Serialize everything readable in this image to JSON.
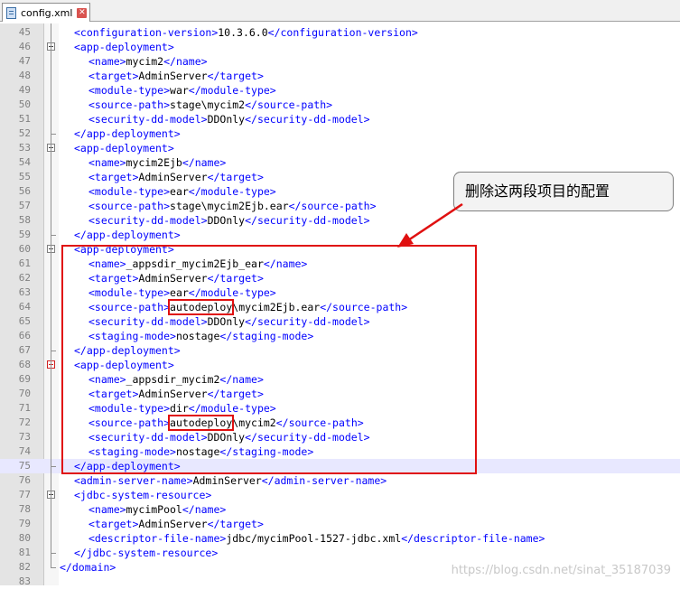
{
  "tab": {
    "label": "config.xml",
    "close": "✕"
  },
  "callout": "删除这两段项目的配置",
  "watermark": "https://blog.csdn.net/sinat_35187039",
  "lines": [
    {
      "n": "45",
      "indent": 1,
      "parts": [
        [
          "t",
          "<configuration-version>"
        ],
        [
          "x",
          "10.3.6.0"
        ],
        [
          "t",
          "</configuration-version>"
        ]
      ]
    },
    {
      "n": "46",
      "indent": 1,
      "fold": "open",
      "parts": [
        [
          "t",
          "<app-deployment>"
        ]
      ]
    },
    {
      "n": "47",
      "indent": 2,
      "parts": [
        [
          "t",
          "<name>"
        ],
        [
          "x",
          "mycim2"
        ],
        [
          "t",
          "</name>"
        ]
      ]
    },
    {
      "n": "48",
      "indent": 2,
      "parts": [
        [
          "t",
          "<target>"
        ],
        [
          "x",
          "AdminServer"
        ],
        [
          "t",
          "</target>"
        ]
      ]
    },
    {
      "n": "49",
      "indent": 2,
      "parts": [
        [
          "t",
          "<module-type>"
        ],
        [
          "x",
          "war"
        ],
        [
          "t",
          "</module-type>"
        ]
      ]
    },
    {
      "n": "50",
      "indent": 2,
      "parts": [
        [
          "t",
          "<source-path>"
        ],
        [
          "x",
          "stage\\mycim2"
        ],
        [
          "t",
          "</source-path>"
        ]
      ]
    },
    {
      "n": "51",
      "indent": 2,
      "parts": [
        [
          "t",
          "<security-dd-model>"
        ],
        [
          "x",
          "DDOnly"
        ],
        [
          "t",
          "</security-dd-model>"
        ]
      ]
    },
    {
      "n": "52",
      "indent": 1,
      "fold": "end",
      "parts": [
        [
          "t",
          "</app-deployment>"
        ]
      ]
    },
    {
      "n": "53",
      "indent": 1,
      "fold": "open",
      "parts": [
        [
          "t",
          "<app-deployment>"
        ]
      ]
    },
    {
      "n": "54",
      "indent": 2,
      "parts": [
        [
          "t",
          "<name>"
        ],
        [
          "x",
          "mycim2Ejb"
        ],
        [
          "t",
          "</name>"
        ]
      ]
    },
    {
      "n": "55",
      "indent": 2,
      "parts": [
        [
          "t",
          "<target>"
        ],
        [
          "x",
          "AdminServer"
        ],
        [
          "t",
          "</target>"
        ]
      ]
    },
    {
      "n": "56",
      "indent": 2,
      "parts": [
        [
          "t",
          "<module-type>"
        ],
        [
          "x",
          "ear"
        ],
        [
          "t",
          "</module-type>"
        ]
      ]
    },
    {
      "n": "57",
      "indent": 2,
      "parts": [
        [
          "t",
          "<source-path>"
        ],
        [
          "x",
          "stage\\mycim2Ejb.ear"
        ],
        [
          "t",
          "</source-path>"
        ]
      ]
    },
    {
      "n": "58",
      "indent": 2,
      "parts": [
        [
          "t",
          "<security-dd-model>"
        ],
        [
          "x",
          "DDOnly"
        ],
        [
          "t",
          "</security-dd-model>"
        ]
      ]
    },
    {
      "n": "59",
      "indent": 1,
      "fold": "end",
      "parts": [
        [
          "t",
          "</app-deployment>"
        ]
      ]
    },
    {
      "n": "60",
      "indent": 1,
      "fold": "open",
      "parts": [
        [
          "t",
          "<app-deployment>"
        ]
      ]
    },
    {
      "n": "61",
      "indent": 2,
      "parts": [
        [
          "t",
          "<name>"
        ],
        [
          "x",
          "_appsdir_mycim2Ejb_ear"
        ],
        [
          "t",
          "</name>"
        ]
      ]
    },
    {
      "n": "62",
      "indent": 2,
      "parts": [
        [
          "t",
          "<target>"
        ],
        [
          "x",
          "AdminServer"
        ],
        [
          "t",
          "</target>"
        ]
      ]
    },
    {
      "n": "63",
      "indent": 2,
      "parts": [
        [
          "t",
          "<module-type>"
        ],
        [
          "x",
          "ear"
        ],
        [
          "t",
          "</module-type>"
        ]
      ]
    },
    {
      "n": "64",
      "indent": 2,
      "parts": [
        [
          "t",
          "<source-path>"
        ],
        [
          "h",
          "autodeploy"
        ],
        [
          "x",
          "\\mycim2Ejb.ear"
        ],
        [
          "t",
          "</source-path>"
        ]
      ]
    },
    {
      "n": "65",
      "indent": 2,
      "parts": [
        [
          "t",
          "<security-dd-model>"
        ],
        [
          "x",
          "DDOnly"
        ],
        [
          "t",
          "</security-dd-model>"
        ]
      ]
    },
    {
      "n": "66",
      "indent": 2,
      "parts": [
        [
          "t",
          "<staging-mode>"
        ],
        [
          "x",
          "nostage"
        ],
        [
          "t",
          "</staging-mode>"
        ]
      ]
    },
    {
      "n": "67",
      "indent": 1,
      "fold": "end",
      "parts": [
        [
          "t",
          "</app-deployment>"
        ]
      ]
    },
    {
      "n": "68",
      "indent": 1,
      "fold": "red",
      "parts": [
        [
          "t",
          "<app-deployment>"
        ]
      ]
    },
    {
      "n": "69",
      "indent": 2,
      "parts": [
        [
          "t",
          "<name>"
        ],
        [
          "x",
          "_appsdir_mycim2"
        ],
        [
          "t",
          "</name>"
        ]
      ]
    },
    {
      "n": "70",
      "indent": 2,
      "parts": [
        [
          "t",
          "<target>"
        ],
        [
          "x",
          "AdminServer"
        ],
        [
          "t",
          "</target>"
        ]
      ]
    },
    {
      "n": "71",
      "indent": 2,
      "parts": [
        [
          "t",
          "<module-type>"
        ],
        [
          "x",
          "dir"
        ],
        [
          "t",
          "</module-type>"
        ]
      ]
    },
    {
      "n": "72",
      "indent": 2,
      "parts": [
        [
          "t",
          "<source-path>"
        ],
        [
          "h",
          "autodeploy"
        ],
        [
          "x",
          "\\mycim2"
        ],
        [
          "t",
          "</source-path>"
        ]
      ]
    },
    {
      "n": "73",
      "indent": 2,
      "parts": [
        [
          "t",
          "<security-dd-model>"
        ],
        [
          "x",
          "DDOnly"
        ],
        [
          "t",
          "</security-dd-model>"
        ]
      ]
    },
    {
      "n": "74",
      "indent": 2,
      "parts": [
        [
          "t",
          "<staging-mode>"
        ],
        [
          "x",
          "nostage"
        ],
        [
          "t",
          "</staging-mode>"
        ]
      ]
    },
    {
      "n": "75",
      "indent": 1,
      "fold": "end",
      "active": true,
      "parts": [
        [
          "t",
          "</app-deployment>"
        ]
      ]
    },
    {
      "n": "76",
      "indent": 1,
      "parts": [
        [
          "t",
          "<admin-server-name>"
        ],
        [
          "x",
          "AdminServer"
        ],
        [
          "t",
          "</admin-server-name>"
        ]
      ]
    },
    {
      "n": "77",
      "indent": 1,
      "fold": "open",
      "parts": [
        [
          "t",
          "<jdbc-system-resource>"
        ]
      ]
    },
    {
      "n": "78",
      "indent": 2,
      "parts": [
        [
          "t",
          "<name>"
        ],
        [
          "x",
          "mycimPool"
        ],
        [
          "t",
          "</name>"
        ]
      ]
    },
    {
      "n": "79",
      "indent": 2,
      "parts": [
        [
          "t",
          "<target>"
        ],
        [
          "x",
          "AdminServer"
        ],
        [
          "t",
          "</target>"
        ]
      ]
    },
    {
      "n": "80",
      "indent": 2,
      "parts": [
        [
          "t",
          "<descriptor-file-name>"
        ],
        [
          "x",
          "jdbc/mycimPool-1527-jdbc.xml"
        ],
        [
          "t",
          "</descriptor-file-name>"
        ]
      ]
    },
    {
      "n": "81",
      "indent": 1,
      "fold": "end",
      "parts": [
        [
          "t",
          "</jdbc-system-resource>"
        ]
      ]
    },
    {
      "n": "82",
      "indent": 0,
      "fold": "last",
      "parts": [
        [
          "t",
          "</domain>"
        ]
      ]
    },
    {
      "n": "83",
      "indent": 0,
      "parts": []
    }
  ]
}
